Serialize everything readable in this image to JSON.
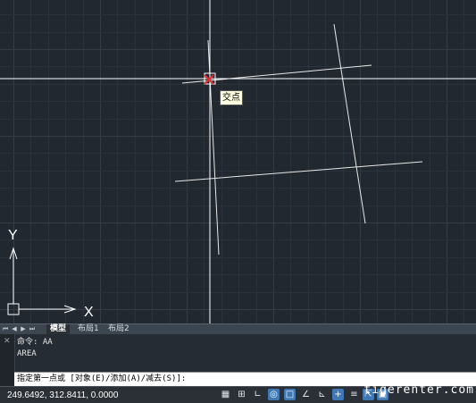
{
  "drawing": {
    "snap_tooltip": "交点",
    "ucs_x_label": "X",
    "ucs_y_label": "Y"
  },
  "layout_tabs": [
    {
      "label": "模型",
      "active": true
    },
    {
      "label": "布局1",
      "active": false
    },
    {
      "label": "布局2",
      "active": false
    }
  ],
  "command": {
    "history": [
      "命令: AA",
      "AREA"
    ],
    "prompt": "指定第一点或 [对象(E)/添加(A)/减去(S)]:"
  },
  "status": {
    "coordinates": "249.6492, 312.8411, 0.0000",
    "icons": [
      "grid-icon",
      "snap-icon",
      "ortho-icon",
      "polar-icon",
      "osnap-icon",
      "otrack-icon",
      "ducs-icon",
      "dyn-icon",
      "lineweight-icon",
      "qp-icon",
      "sc-icon"
    ],
    "watermark": "tigerenter.com"
  },
  "colors": {
    "viewport_bg": "#212830",
    "snap_marker": "#e03030",
    "active_toggle": "#3f78b5"
  }
}
